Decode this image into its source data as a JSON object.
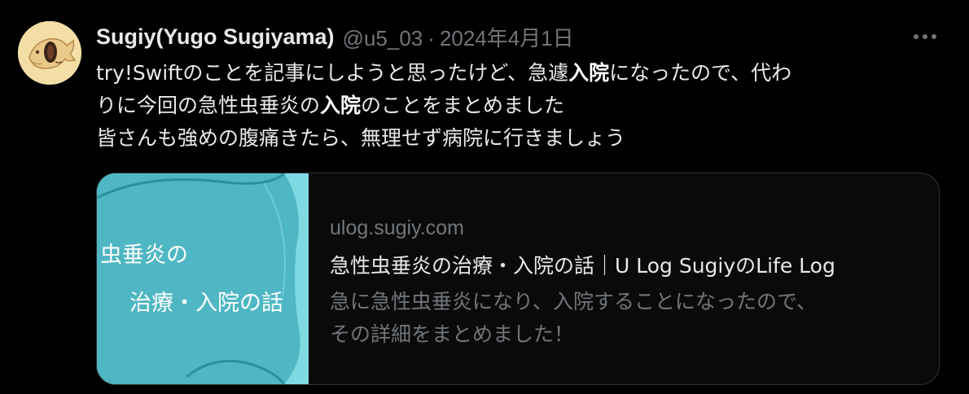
{
  "tweet": {
    "author": {
      "display_name": "Sugiy(Yugo Sugiyama)",
      "handle": "@u5_03",
      "avatar_icon": "taiyaki-avatar-icon"
    },
    "separator": "·",
    "date": "2024年4月1日",
    "more_icon": "more-horizontal-icon",
    "text": {
      "line1_a": "try!Swiftのことを記事にしようと思ったけど、急遽",
      "line1_b": "入院",
      "line1_c": "になったので、代わ",
      "line2_a": "りに今回の急性虫垂炎の",
      "line2_b": "入院",
      "line2_c": "のことをまとめました",
      "line3": "皆さんも強めの腹痛きたら、無理せず病院に行きましょう"
    }
  },
  "link_card": {
    "thumbnail": {
      "line1": "虫垂炎の",
      "line2": "治療・入院の話"
    },
    "domain": "ulog.sugiy.com",
    "title": "急性虫垂炎の治療・入院の話｜U Log SugiyのLife Log",
    "description_line1": "急に急性虫垂炎になり、入院することになったので、",
    "description_line2": "その詳細をまとめました！"
  },
  "colors": {
    "background": "#000000",
    "text_primary": "#e7e9ea",
    "text_secondary": "#71767b",
    "card_border": "#2f3336",
    "thumb_light": "#7fd9e2",
    "thumb_dark": "#4fb7c3"
  }
}
